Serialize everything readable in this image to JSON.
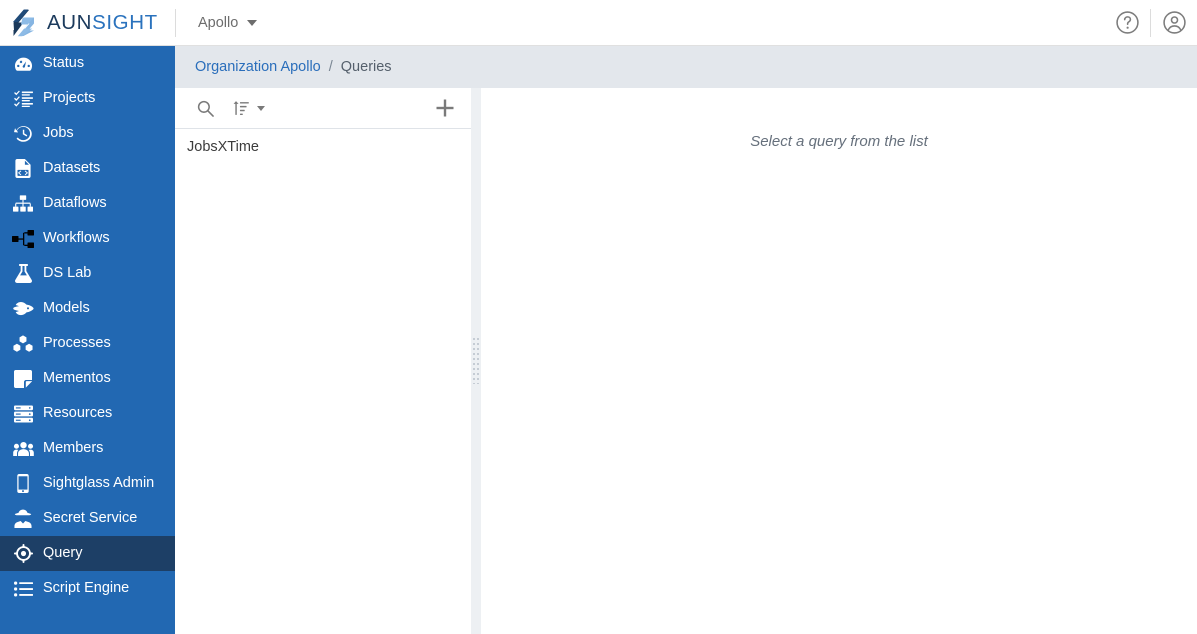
{
  "header": {
    "brand_aun": "AUN",
    "brand_sight": "SIGHT",
    "logo_icon": "aunsight-logo-icon",
    "org_name": "Apollo",
    "org_caret_icon": "caret-down-icon",
    "help_icon": "question-circle-icon",
    "account_icon": "user-circle-icon"
  },
  "sidebar": {
    "items": [
      {
        "label": "Status",
        "icon": "tachometer-icon",
        "active": false
      },
      {
        "label": "Projects",
        "icon": "tasks-list-icon",
        "active": false
      },
      {
        "label": "Jobs",
        "icon": "history-clock-icon",
        "active": false
      },
      {
        "label": "Datasets",
        "icon": "file-code-icon",
        "active": false
      },
      {
        "label": "Dataflows",
        "icon": "sitemap-icon",
        "active": false
      },
      {
        "label": "Workflows",
        "icon": "project-diagram-icon",
        "active": false
      },
      {
        "label": "DS Lab",
        "icon": "flask-icon",
        "active": false
      },
      {
        "label": "Models",
        "icon": "rocket-icon",
        "active": false
      },
      {
        "label": "Processes",
        "icon": "cubes-icon",
        "active": false
      },
      {
        "label": "Mementos",
        "icon": "sticky-note-icon",
        "active": false
      },
      {
        "label": "Resources",
        "icon": "server-icon",
        "active": false
      },
      {
        "label": "Members",
        "icon": "users-icon",
        "active": false
      },
      {
        "label": "Sightglass Admin",
        "icon": "mobile-icon",
        "active": false
      },
      {
        "label": "Secret Service",
        "icon": "user-secret-icon",
        "active": false
      },
      {
        "label": "Query",
        "icon": "crosshair-icon",
        "active": true
      },
      {
        "label": "Script Engine",
        "icon": "list-ul-icon",
        "active": false
      }
    ]
  },
  "breadcrumb": {
    "link_label": "Organization Apollo",
    "separator": "/",
    "current_label": "Queries"
  },
  "list_panel": {
    "toolbar": {
      "search_icon": "search-icon",
      "sort_icon": "sort-amount-icon",
      "sort_caret_icon": "caret-down-icon",
      "add_icon": "plus-icon"
    },
    "queries": [
      {
        "name": "JobsXTime"
      }
    ]
  },
  "detail_panel": {
    "empty_message": "Select a query from the list"
  },
  "colors": {
    "sidebar_blue": "#2268B2",
    "sidebar_active": "#1D3F66",
    "breadcrumb_bg": "#E3E7EC",
    "link_blue": "#2A6EBB",
    "brand_dark": "#1B3A5C",
    "brand_light": "#2A72BD"
  }
}
